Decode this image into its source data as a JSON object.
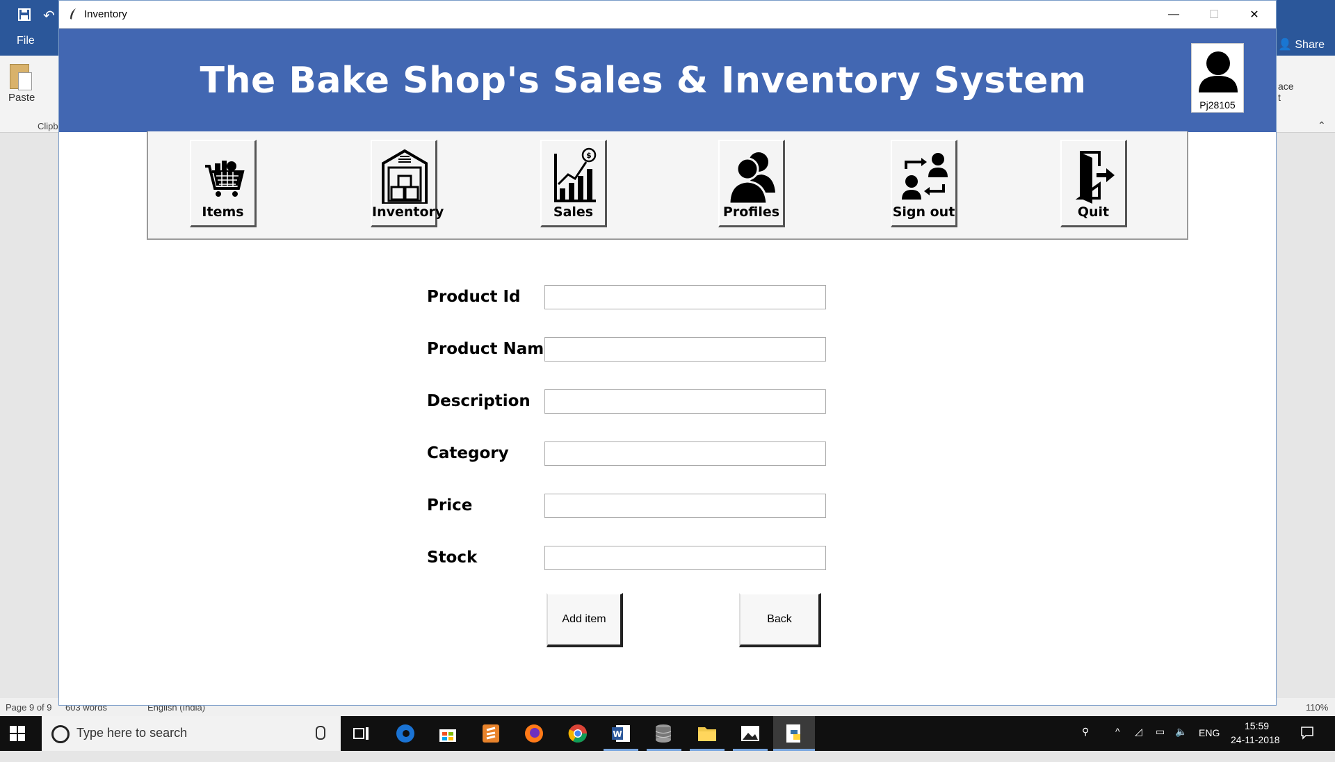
{
  "word": {
    "file_label": "File",
    "share_label": "Share",
    "paste_label": "Paste",
    "clipboard_label": "Clipb",
    "ribbon_right_a": "ace",
    "ribbon_right_b": "t",
    "status": {
      "page": "Page 9 of 9",
      "words": "603 words",
      "language": "English (India)",
      "zoom": "110%"
    }
  },
  "window": {
    "title": "Inventory",
    "controls": {
      "minimize": "—",
      "maximize": "☐",
      "close": "✕"
    }
  },
  "banner": {
    "title": "The Bake Shop's Sales & Inventory System",
    "username": "Pj28105"
  },
  "nav": [
    {
      "label": "Items",
      "icon": "shopping-cart-icon"
    },
    {
      "label": "Inventory",
      "icon": "warehouse-icon"
    },
    {
      "label": "Sales",
      "icon": "sales-chart-icon"
    },
    {
      "label": "Profiles",
      "icon": "profiles-icon"
    },
    {
      "label": "Sign out",
      "icon": "switch-user-icon"
    },
    {
      "label": "Quit",
      "icon": "exit-door-icon"
    }
  ],
  "form": {
    "fields": [
      {
        "label": "Product Id",
        "value": ""
      },
      {
        "label": "Product Name",
        "value": ""
      },
      {
        "label": "Description",
        "value": ""
      },
      {
        "label": "Category",
        "value": ""
      },
      {
        "label": "Price",
        "value": ""
      },
      {
        "label": "Stock",
        "value": ""
      }
    ],
    "add_label": "Add item",
    "back_label": "Back"
  },
  "taskbar": {
    "search_placeholder": "Type here to search",
    "language": "ENG",
    "time": "15:59",
    "date": "24-11-2018",
    "apps": [
      "task-view-icon",
      "edge-icon",
      "store-icon",
      "sublime-icon",
      "firefox-icon",
      "chrome-icon",
      "word-icon",
      "database-icon",
      "file-explorer-icon",
      "photos-icon",
      "python-icon"
    ]
  }
}
